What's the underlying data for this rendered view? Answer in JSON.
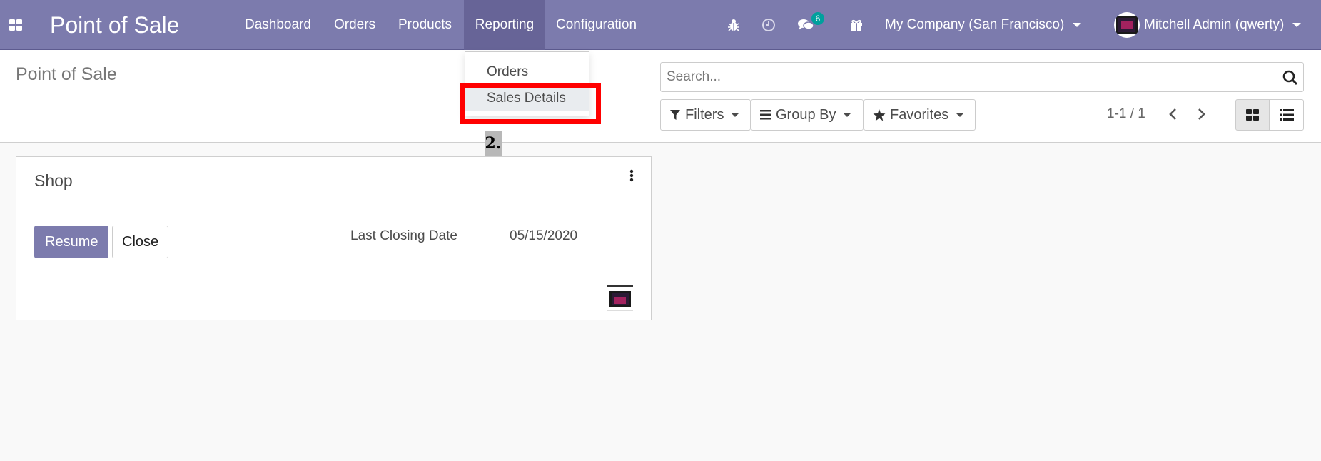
{
  "navbar": {
    "brand": "Point of Sale",
    "menu": [
      {
        "label": "Dashboard"
      },
      {
        "label": "Orders"
      },
      {
        "label": "Products"
      },
      {
        "label": "Reporting",
        "active": true
      },
      {
        "label": "Configuration"
      }
    ],
    "messages_badge": "6",
    "company": "My Company (San Francisco)",
    "user": "Mitchell Admin (qwerty)"
  },
  "reporting_dropdown": {
    "items": [
      {
        "label": "Orders"
      },
      {
        "label": "Sales Details",
        "highlighted": true
      }
    ]
  },
  "annotation": {
    "step": "2."
  },
  "control_panel": {
    "title": "Point of Sale",
    "search_placeholder": "Search...",
    "filters_label": "Filters",
    "groupby_label": "Group By",
    "favorites_label": "Favorites",
    "pager": "1-1 / 1"
  },
  "kanban": {
    "cards": [
      {
        "name": "Shop",
        "resume_label": "Resume",
        "close_label": "Close",
        "closing_date_label": "Last Closing Date",
        "closing_date": "05/15/2020"
      }
    ]
  },
  "colors": {
    "brand": "#7c7bad",
    "badge": "#00a09d",
    "highlight": "#ff0000"
  },
  "icons": [
    "apps-grid-icon",
    "bug-icon",
    "clock-icon",
    "chat-icon",
    "gift-icon",
    "filter-icon",
    "bars-icon",
    "star-icon",
    "search-icon",
    "chevron-left-icon",
    "chevron-right-icon",
    "kanban-view-icon",
    "list-view-icon",
    "ellipsis-v-icon"
  ]
}
